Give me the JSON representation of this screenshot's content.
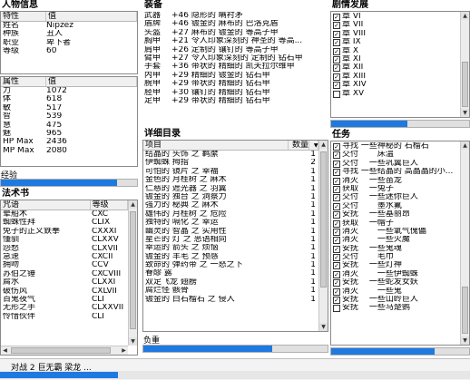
{
  "character": {
    "title": "人物信息",
    "header": [
      "特性",
      "值"
    ],
    "rows": [
      [
        "姓名",
        "Nipzez"
      ],
      [
        "种族",
        "丑人"
      ],
      [
        "职业",
        "卑下者"
      ],
      [
        "等级",
        "60"
      ]
    ],
    "attr_header": [
      "属性",
      "值"
    ],
    "attrs": [
      [
        "力",
        "1072"
      ],
      [
        "体",
        "618"
      ],
      [
        "敏",
        "517"
      ],
      [
        "智",
        "539"
      ],
      [
        "慧",
        "475"
      ],
      [
        "魅",
        "965"
      ],
      [
        "HP Max",
        "2436"
      ],
      [
        "MP Max",
        "2080"
      ]
    ],
    "exp_label": "经验",
    "exp_fraction": 0.85
  },
  "spells": {
    "title": "法术书",
    "header": [
      "咒语",
      "等级"
    ],
    "rows": [
      [
        "晕船术",
        "CXC"
      ],
      [
        "蜘蛛性拜",
        "CLIX"
      ],
      [
        "免子的正义鉄拳",
        "CXXXI"
      ],
      [
        "懂驯",
        "CLXXV"
      ],
      [
        "怨愁",
        "CLXVII"
      ],
      [
        "急速",
        "CXCII"
      ],
      [
        "拥吻",
        "CCV"
      ],
      [
        "苏伯之锤",
        "CXCVIII"
      ],
      [
        "腐水",
        "CLXXI"
      ],
      [
        "破伤风",
        "CXLVII"
      ],
      [
        "百鬼夜气",
        "CLI"
      ],
      [
        "无形之手",
        "CLXXVII"
      ],
      [
        "怜惜伙伴",
        "CLI"
      ]
    ]
  },
  "equipment": {
    "title": "装备",
    "rows": [
      [
        "武器",
        "+46 隐形的 瞒衬矛"
      ],
      [
        "盾牌",
        "+46 镀金的 麻布的 巴洛克盾"
      ],
      [
        "头盔",
        "+27 麻布的 镀金的 等高子甲"
      ],
      [
        "胸甲",
        "+21 令人印象深刻的 神圣的 等高..."
      ],
      [
        "肩甲",
        "+26 定制的 镶钉的 等高子甲"
      ],
      [
        "臂甲",
        "+27 令人印象深刻的 定制的 钻石甲"
      ],
      [
        "手套",
        "+36 带状的 精细的 凯夫拉尔维甲"
      ],
      [
        "内甲",
        "+29 精细的 镀金的 钻石甲"
      ],
      [
        "腕甲",
        "+29 带状的 精细的 钻石甲"
      ],
      [
        "胫甲",
        "+30 镶钉的 精细的 钻石甲"
      ],
      [
        "足甲",
        "+29 带状的 精细的 钻石甲"
      ]
    ]
  },
  "inventory": {
    "title": "详细目录",
    "header": [
      "项目",
      "数量"
    ],
    "rows": [
      [
        "结晶的 头饰 之 羁縻",
        "1"
      ],
      [
        "伊蜘蛛 拇指",
        "2"
      ],
      [
        "可怕的 镜片 之 幸福",
        "1"
      ],
      [
        "金色的 月桂树 之 麻木",
        "1"
      ],
      [
        "仁慈的 遮光器 之 羽翼",
        "1"
      ],
      [
        "镀金的 独台 之 洞察力",
        "1"
      ],
      [
        "强力的 秘典 之 麻木",
        "1"
      ],
      [
        "雄伟的 月桂树 之 危险",
        "1"
      ],
      [
        "独特的 嗝化 之 幸运",
        "1"
      ],
      [
        "幽灵的 智晶 之 实用性",
        "1"
      ],
      [
        "星芒的 灯 之 恶语相向",
        "1"
      ],
      [
        "幸运的 箭头 之 烦恼",
        "1"
      ],
      [
        "镀金的 羊毛 之 预感",
        "1"
      ],
      [
        "致命的 弹药带 之 一怒之下",
        "1"
      ],
      [
        "眷醪 露",
        "1"
      ],
      [
        "双足飞龙 翅膀",
        "1"
      ],
      [
        "腐烂怪 骸骨",
        "1"
      ],
      [
        "镀金的 白石榴石 之 侵入",
        "1"
      ]
    ],
    "burden_label": "负重",
    "burden_fraction": 0.7
  },
  "plot": {
    "title": "剧情发展",
    "rows": [
      [
        "checked",
        "章 VI"
      ],
      [
        "checked",
        "章 VII"
      ],
      [
        "checked",
        "章 VIII"
      ],
      [
        "checked",
        "章 IX"
      ],
      [
        "checked",
        "章 X"
      ],
      [
        "checked",
        "章 XI"
      ],
      [
        "checked",
        "章 XII"
      ],
      [
        "checked",
        "章 XIII"
      ],
      [
        "checked",
        "章 XIV"
      ],
      [
        "unchecked",
        "章 XV"
      ]
    ],
    "progress_fraction": 0.55
  },
  "quests": {
    "title": "任务",
    "rows": [
      [
        "checked",
        "寻找 一些神秘的 石榴石"
      ],
      [
        "checked",
        "交付 　　床温"
      ],
      [
        "checked",
        "交付 　一些巩翼巨人"
      ],
      [
        "checked",
        "寻找 一些结晶的 高晶晶的小..."
      ],
      [
        "checked",
        "消灭 　一些苗龙"
      ],
      [
        "checked",
        "获取 　一兔子"
      ],
      [
        "checked",
        "交付 　一些迷你巨人"
      ],
      [
        "checked",
        "交付 　　墨水氟"
      ],
      [
        "checked",
        "安抚 　一些基丽昂"
      ],
      [
        "checked",
        "获取 　一帽子"
      ],
      [
        "checked",
        "消灭 　　一些氧气傀儡"
      ],
      [
        "checked",
        "消灭 　　一些火魔"
      ],
      [
        "checked",
        "安抚 　一些鬼魂"
      ],
      [
        "checked",
        "交付 　　毛巾"
      ],
      [
        "checked",
        "安抚 　一些灯神"
      ],
      [
        "checked",
        "消灭 　　一些伊蜘蛛"
      ],
      [
        "checked",
        "安抚 　一些蛇发女妖"
      ],
      [
        "checked",
        "消灭 　　一些鬼"
      ],
      [
        "checked",
        "安抚 　一些山岭巨人"
      ],
      [
        "unchecked",
        "安抚 　一些马楚鹦"
      ]
    ],
    "progress_fraction": 0.75
  },
  "status": {
    "text": "对战 2 巨无霸 梁龙 ...",
    "progress_fraction": 0.25
  },
  "colors": {
    "bar": "#1e7ae0"
  }
}
